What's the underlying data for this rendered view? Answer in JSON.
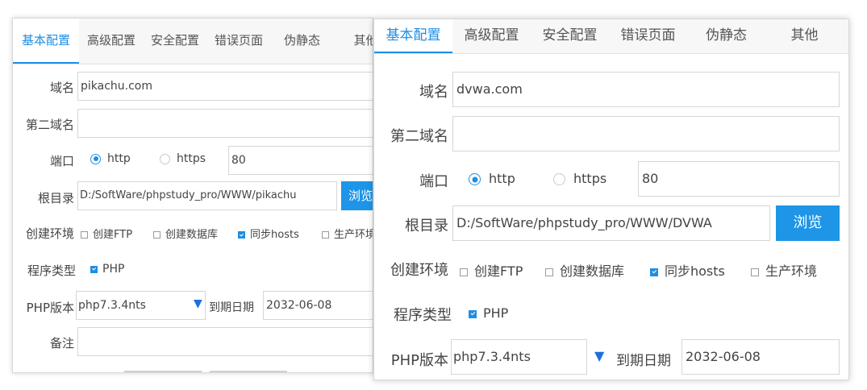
{
  "tabs": [
    "基本配置",
    "高级配置",
    "安全配置",
    "错误页面",
    "伪静态",
    "其他"
  ],
  "labels": {
    "domain": "域名",
    "second_domain": "第二域名",
    "port": "端口",
    "root": "根目录",
    "env": "创建环境",
    "program_type": "程序类型",
    "php_version": "PHP版本",
    "expire": "到期日期",
    "note": "备注"
  },
  "radio": {
    "http": "http",
    "https": "https"
  },
  "browse": "浏览",
  "env_options": [
    "创建FTP",
    "创建数据库",
    "同步hosts",
    "生产环境"
  ],
  "env_checked": [
    false,
    false,
    true,
    false
  ],
  "program_option": "PHP",
  "program_checked": true,
  "select_arrow": "▼",
  "left": {
    "tab_last_visible": "其他",
    "domain": "pikachu.com",
    "second_domain": "",
    "port": "80",
    "root": "D:/SoftWare/phpstudy_pro/WWW/pikachu",
    "browse_visible": "浏览",
    "env_last_visible": "生产环境",
    "php_version": "php7.3.4nts",
    "expire": "2032-06-08",
    "note": ""
  },
  "right": {
    "domain": "dvwa.com",
    "second_domain": "",
    "port": "80",
    "root": "D:/SoftWare/phpstudy_pro/WWW/DVWA",
    "php_version": "php7.3.4nts",
    "expire": "2032-06-08"
  },
  "colors": {
    "accent": "#1e8ee5",
    "button": "#1e95e6"
  }
}
